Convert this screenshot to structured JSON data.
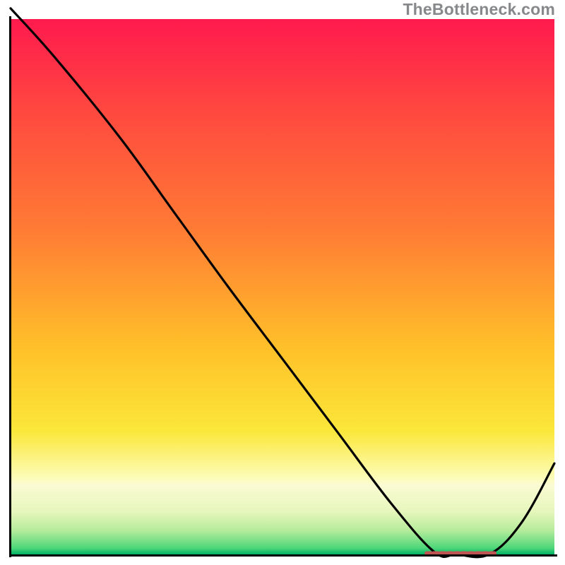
{
  "watermark": "TheBottleneck.com",
  "chart_data": {
    "type": "line",
    "title": "",
    "xlabel": "",
    "ylabel": "",
    "xlim": [
      0,
      100
    ],
    "ylim": [
      0,
      100
    ],
    "x": [
      0,
      8,
      20,
      30,
      40,
      50,
      60,
      70,
      78,
      82,
      88,
      94,
      100
    ],
    "values": [
      102,
      93,
      78,
      64,
      50,
      36.5,
      23,
      9.5,
      0.4,
      0,
      0,
      6,
      17
    ],
    "legend": false,
    "grid": false,
    "optimum_marker": {
      "x_start": 76.5,
      "x_end": 89,
      "y": 0.2,
      "color": "#bf5552"
    },
    "background_gradient": [
      {
        "stop": 0,
        "color": "#ff1a4e"
      },
      {
        "stop": 0.18,
        "color": "#ff4a3f"
      },
      {
        "stop": 0.4,
        "color": "#ff7d34"
      },
      {
        "stop": 0.62,
        "color": "#ffc229"
      },
      {
        "stop": 0.77,
        "color": "#fbe73a"
      },
      {
        "stop": 0.855,
        "color": "#fcfcb5"
      },
      {
        "stop": 0.87,
        "color": "#fbfbd3"
      },
      {
        "stop": 0.92,
        "color": "#e6f6bc"
      },
      {
        "stop": 0.955,
        "color": "#b6ec9b"
      },
      {
        "stop": 0.988,
        "color": "#4fd77a"
      },
      {
        "stop": 1.0,
        "color": "#00b264"
      }
    ]
  }
}
